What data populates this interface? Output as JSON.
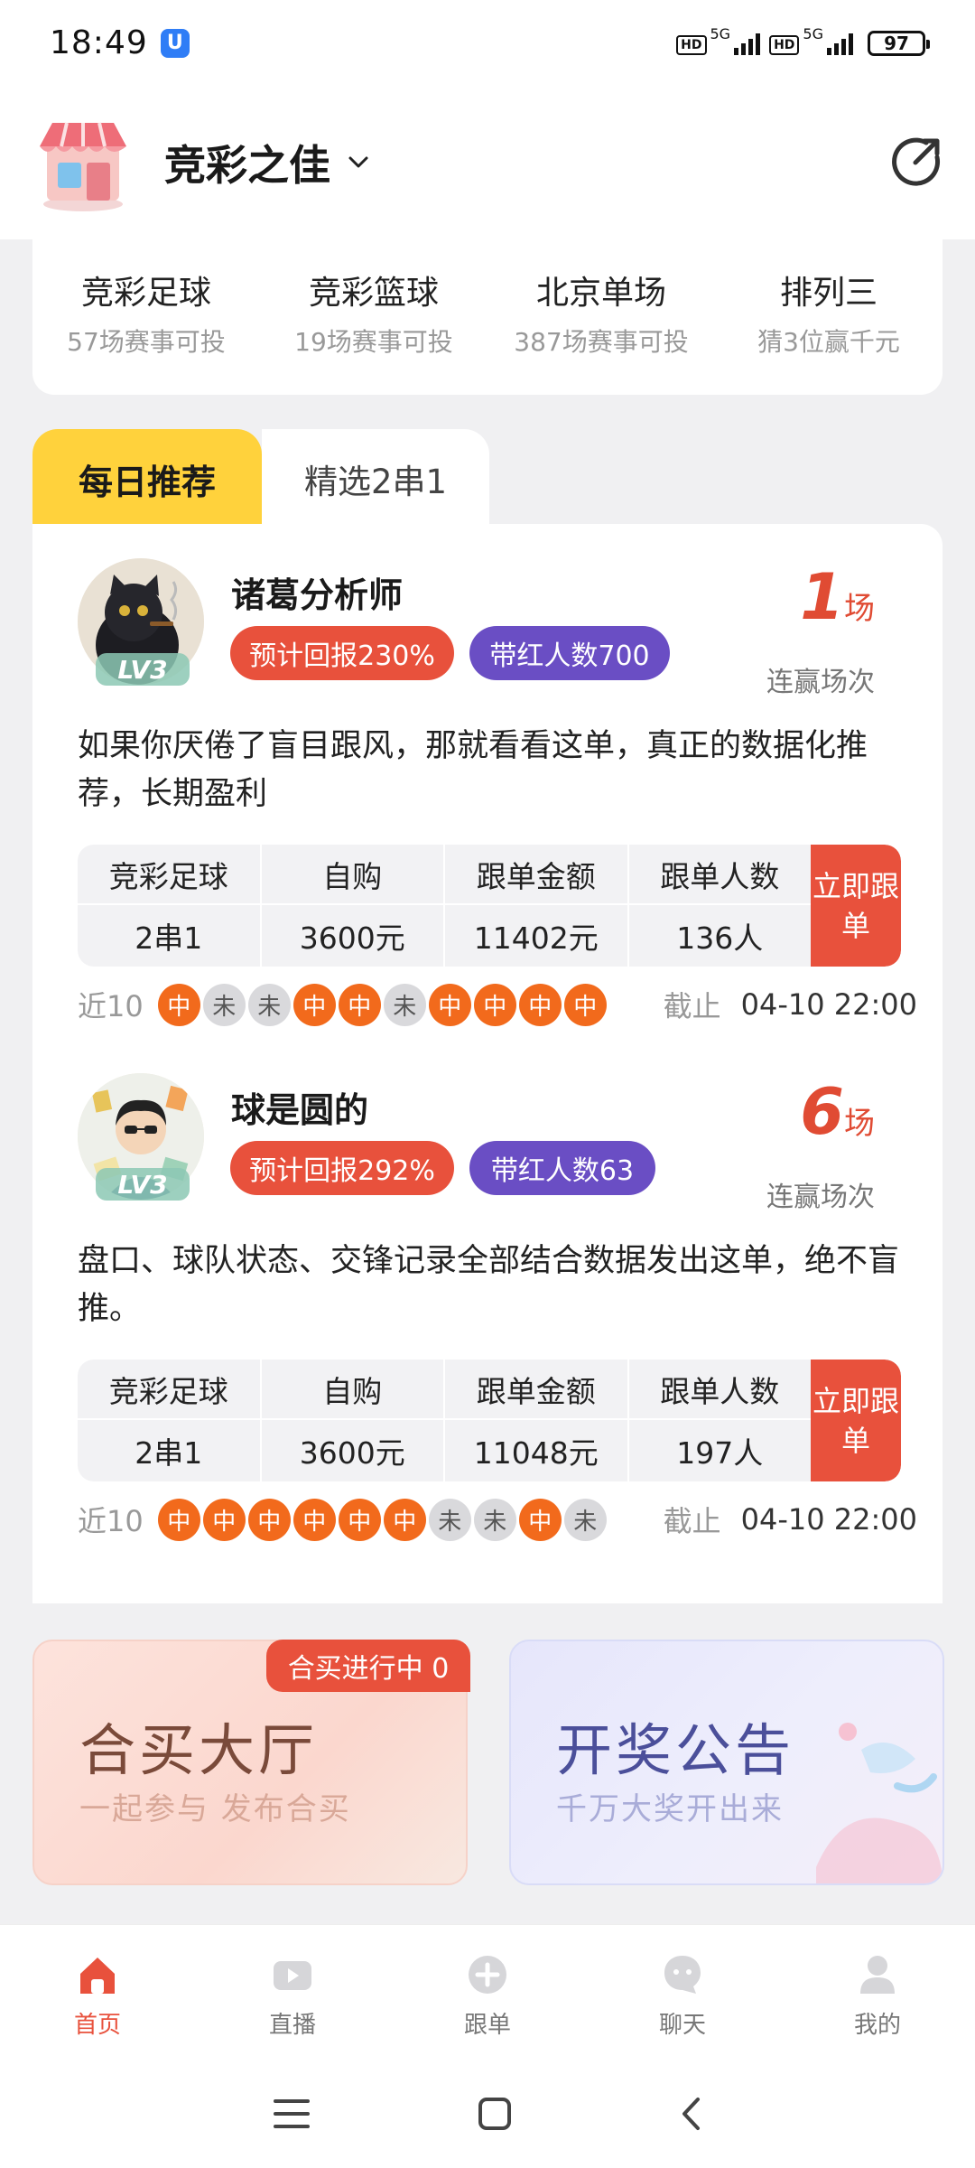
{
  "status_bar": {
    "time": "18:49",
    "app_badge": "U",
    "network": "5G",
    "hd": "HD",
    "battery": "97"
  },
  "header": {
    "title": "竞彩之佳"
  },
  "lotteries": [
    {
      "name": "竞彩足球",
      "sub": "57场赛事可投"
    },
    {
      "name": "竞彩篮球",
      "sub": "19场赛事可投"
    },
    {
      "name": "北京单场",
      "sub": "387场赛事可投"
    },
    {
      "name": "排列三",
      "sub": "猜3位赢千元"
    }
  ],
  "tabs": [
    {
      "label": "每日推荐",
      "active": true
    },
    {
      "label": "精选2串1",
      "active": false
    }
  ],
  "recommendations": [
    {
      "name": "诸葛分析师",
      "level": "LV3",
      "return_tag": "预计回报230%",
      "red_tag": "带红人数700",
      "streak": "1",
      "streak_unit": "场",
      "streak_label": "连赢场次",
      "intro": "如果你厌倦了盲目跟风，那就看看这单，真正的数据化推荐，长期盈利",
      "headers": [
        "竞彩足球",
        "自购",
        "跟单金额",
        "跟单人数"
      ],
      "values": [
        "2串1",
        "3600元",
        "11402元",
        "136人"
      ],
      "follow_label": "立即跟单",
      "recent_label": "近10",
      "results": [
        "中",
        "未",
        "未",
        "中",
        "中",
        "未",
        "中",
        "中",
        "中",
        "中"
      ],
      "deadline_label": "截止",
      "deadline": "04-10 22:00"
    },
    {
      "name": "球是圆的",
      "level": "LV3",
      "return_tag": "预计回报292%",
      "red_tag": "带红人数63",
      "streak": "6",
      "streak_unit": "场",
      "streak_label": "连赢场次",
      "intro": "盘口、球队状态、交锋记录全部结合数据发出这单，绝不盲推。",
      "headers": [
        "竞彩足球",
        "自购",
        "跟单金额",
        "跟单人数"
      ],
      "values": [
        "2串1",
        "3600元",
        "11048元",
        "197人"
      ],
      "follow_label": "立即跟单",
      "recent_label": "近10",
      "results": [
        "中",
        "中",
        "中",
        "中",
        "中",
        "中",
        "未",
        "未",
        "中",
        "未"
      ],
      "deadline_label": "截止",
      "deadline": "04-10 22:00"
    }
  ],
  "promo": {
    "group": {
      "title": "合买大厅",
      "sub": "一起参与 发布合买",
      "badge": "合买进行中 0"
    },
    "lottery": {
      "title": "开奖公告",
      "sub": "千万大奖开出来"
    }
  },
  "bottom_nav": [
    {
      "label": "首页",
      "icon": "home-icon",
      "active": true
    },
    {
      "label": "直播",
      "icon": "live-icon",
      "active": false
    },
    {
      "label": "跟单",
      "icon": "follow-icon",
      "active": false
    },
    {
      "label": "聊天",
      "icon": "chat-icon",
      "active": false
    },
    {
      "label": "我的",
      "icon": "profile-icon",
      "active": false
    }
  ],
  "colors": {
    "accent": "#e8513c",
    "tab_active": "#ffd23c",
    "purple_tag": "#6a4ec4",
    "hit_ball": "#f26a1c"
  }
}
